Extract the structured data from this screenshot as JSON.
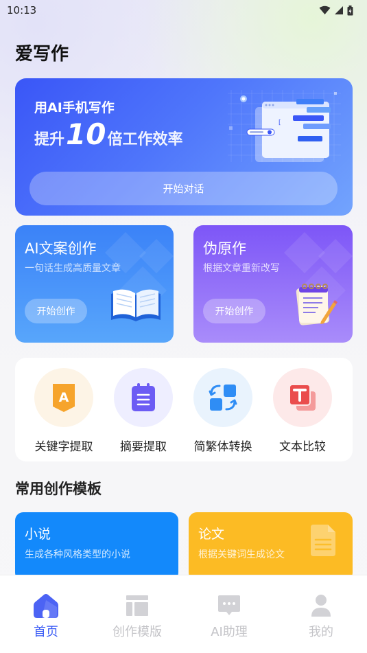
{
  "status_bar": {
    "time": "10:13"
  },
  "app": {
    "title": "爱写作"
  },
  "hero": {
    "subtitle": "用AI手机写作",
    "headline_prefix": "提升",
    "headline_number": "10",
    "headline_suffix": "倍工作效率",
    "button_label": "开始对话"
  },
  "feature_cards": [
    {
      "title": "AI文案创作",
      "description": "一句话生成高质量文章",
      "button_label": "开始创作"
    },
    {
      "title": "伪原作",
      "description": "根据文章重新改写",
      "button_label": "开始创作"
    }
  ],
  "tools": [
    {
      "label": "关键字提取",
      "icon": "keyword-badge-icon"
    },
    {
      "label": "摘要提取",
      "icon": "clipboard-list-icon"
    },
    {
      "label": "简繁体转换",
      "icon": "convert-arrows-icon"
    },
    {
      "label": "文本比较",
      "icon": "text-compare-icon"
    }
  ],
  "section": {
    "title": "常用创作模板"
  },
  "templates": [
    {
      "title": "小说",
      "description": "生成各种风格类型的小说"
    },
    {
      "title": "论文",
      "description": "根据关键词生成论文"
    }
  ],
  "bottom_nav": [
    {
      "label": "首页",
      "icon": "home-icon",
      "active": true
    },
    {
      "label": "创作模版",
      "icon": "template-icon",
      "active": false
    },
    {
      "label": "AI助理",
      "icon": "chat-bubble-icon",
      "active": false
    },
    {
      "label": "我的",
      "icon": "user-icon",
      "active": false
    }
  ],
  "colors": {
    "accent": "#3a5bf5",
    "hero_start": "#3a56f7",
    "hero_end": "#73a4fd",
    "card_blue": "#3b82f8",
    "card_purple": "#7d56f7",
    "template_blue": "#1389fb",
    "template_yellow": "#fcbb24"
  }
}
